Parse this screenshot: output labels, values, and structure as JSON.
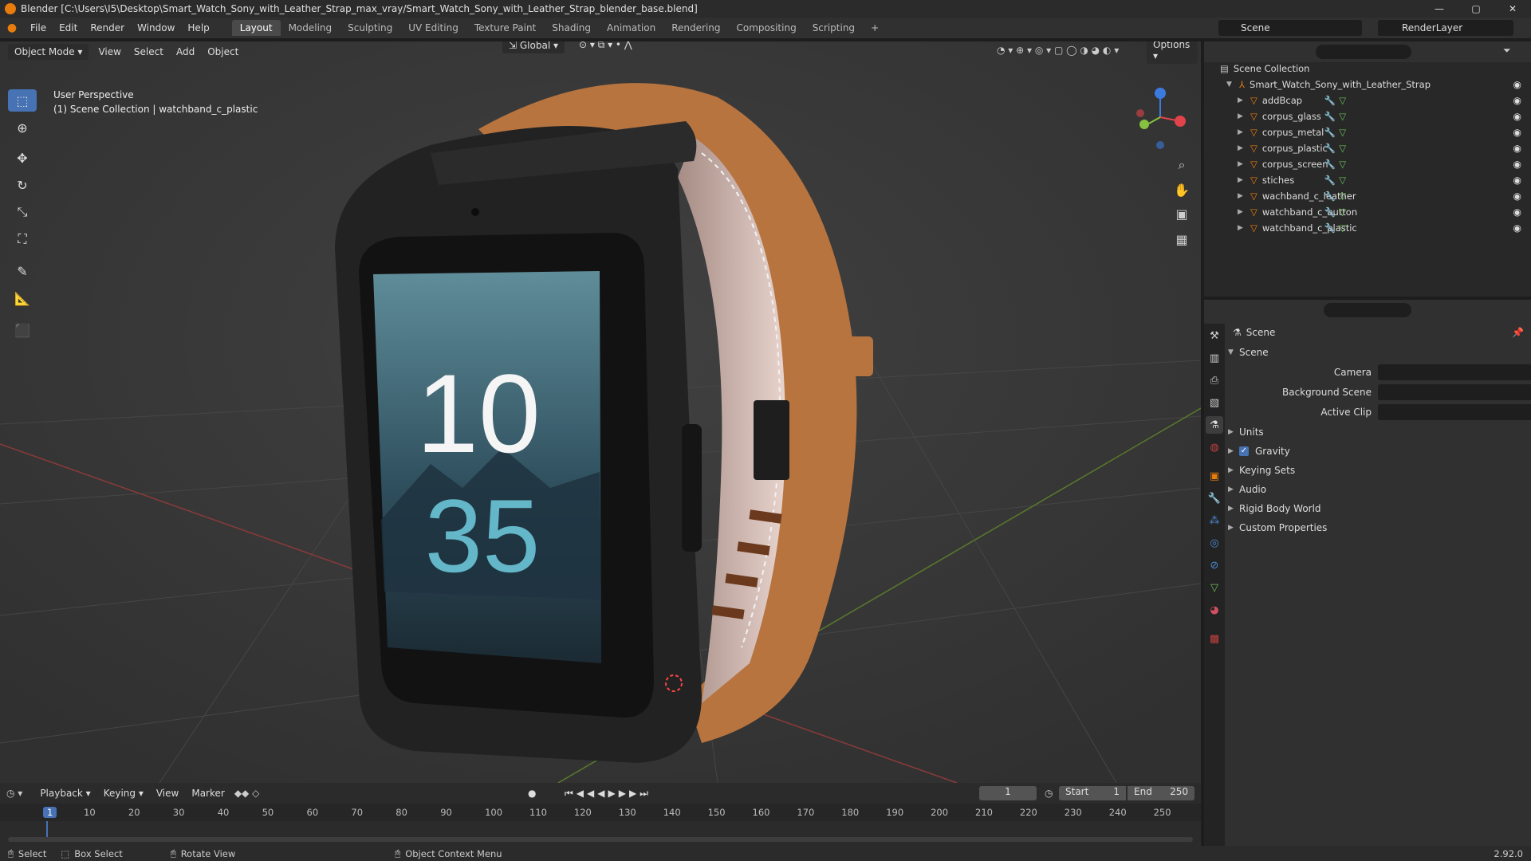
{
  "window": {
    "title": "Blender [C:\\Users\\I5\\Desktop\\Smart_Watch_Sony_with_Leather_Strap_max_vray/Smart_Watch_Sony_with_Leather_Strap_blender_base.blend]",
    "minimize": "—",
    "maximize": "▢",
    "close": "✕"
  },
  "menu": [
    "File",
    "Edit",
    "Render",
    "Window",
    "Help"
  ],
  "workspaces": [
    "Layout",
    "Modeling",
    "Sculpting",
    "UV Editing",
    "Texture Paint",
    "Shading",
    "Animation",
    "Rendering",
    "Compositing",
    "Scripting"
  ],
  "scene_field": "Scene",
  "renderlayer_field": "RenderLayer",
  "viewport": {
    "transform_orientation": "Global",
    "options": "Options",
    "mode": "Object Mode",
    "menus": [
      "View",
      "Select",
      "Add",
      "Object"
    ],
    "overlay_line1": "User Perspective",
    "overlay_line2": "(1) Scene Collection | watchband_c_plastic",
    "watch_hours": "10",
    "watch_minutes": "35"
  },
  "outliner": {
    "root": "Scene Collection",
    "collection": "Smart_Watch_Sony_with_Leather_Strap",
    "objects": [
      "addBcap",
      "corpus_glass",
      "corpus_metal",
      "corpus_plastic",
      "corpus_screen",
      "stiches",
      "wachband_c_leather",
      "watchband_c_button",
      "watchband_c_plastic"
    ]
  },
  "properties": {
    "context": "Scene",
    "panel": "Scene",
    "camera_label": "Camera",
    "background_label": "Background Scene",
    "clip_label": "Active Clip",
    "sections": [
      "Units",
      "Gravity",
      "Keying Sets",
      "Audio",
      "Rigid Body World",
      "Custom Properties"
    ]
  },
  "timeline": {
    "menus": [
      "Playback",
      "Keying",
      "View",
      "Marker"
    ],
    "current_frame": "1",
    "start_label": "Start",
    "start": "1",
    "end_label": "End",
    "end": "250",
    "ruler": [
      "1",
      "10",
      "20",
      "30",
      "40",
      "50",
      "60",
      "70",
      "80",
      "90",
      "100",
      "110",
      "120",
      "130",
      "140",
      "150",
      "160",
      "170",
      "180",
      "190",
      "200",
      "210",
      "220",
      "230",
      "240",
      "250"
    ]
  },
  "status": {
    "select": "Select",
    "box_select": "Box Select",
    "rotate": "Rotate View",
    "context_menu": "Object Context Menu",
    "version": "2.92.0"
  },
  "colors": {
    "accent": "#4772b3",
    "object_orange": "#e87d0d",
    "mesh_green": "#6bbf59",
    "leather": "#b8743f"
  }
}
